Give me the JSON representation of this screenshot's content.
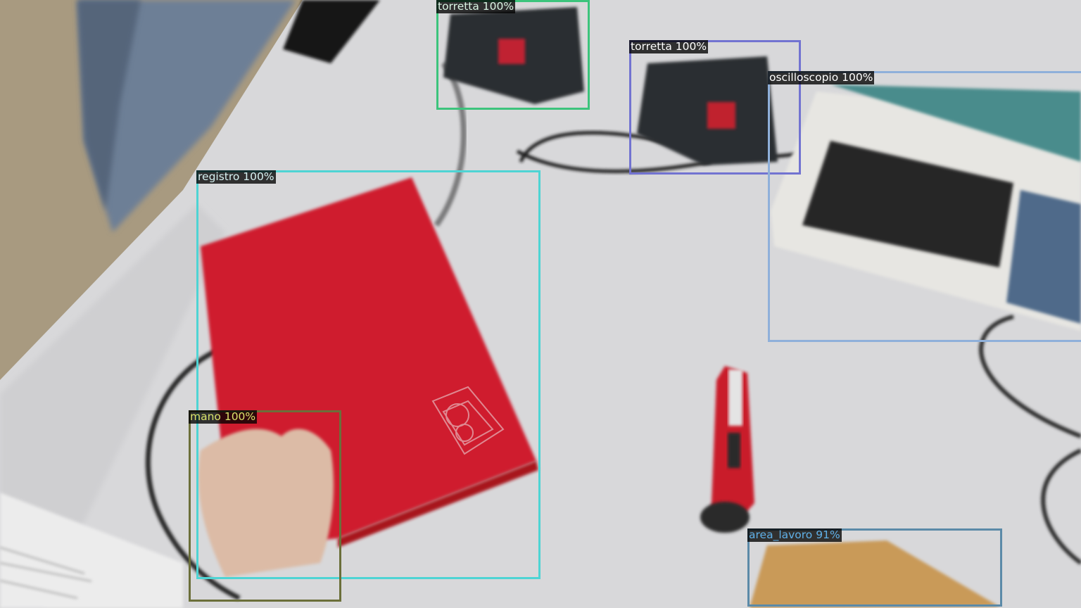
{
  "detections": [
    {
      "id": "torretta-1",
      "label": "torretta 100%",
      "color": "#3cc47c",
      "text_color": "#d9f5e3"
    },
    {
      "id": "torretta-2",
      "label": "torretta 100%",
      "color": "#7273d1",
      "text_color": "#ffffff"
    },
    {
      "id": "oscilloscopio",
      "label": "oscilloscopio 100%",
      "color": "#8fb0da",
      "text_color": "#ffffff"
    },
    {
      "id": "registro",
      "label": "registro 100%",
      "color": "#4ed4d4",
      "text_color": "#d6f2f2"
    },
    {
      "id": "mano",
      "label": "mano 100%",
      "color": "#6b6f3a",
      "text_color": "#d9e36a"
    },
    {
      "id": "area-lavoro",
      "label": "area_lavoro 91%",
      "color": "#5b8aa8",
      "text_color": "#5fb0e8"
    }
  ]
}
